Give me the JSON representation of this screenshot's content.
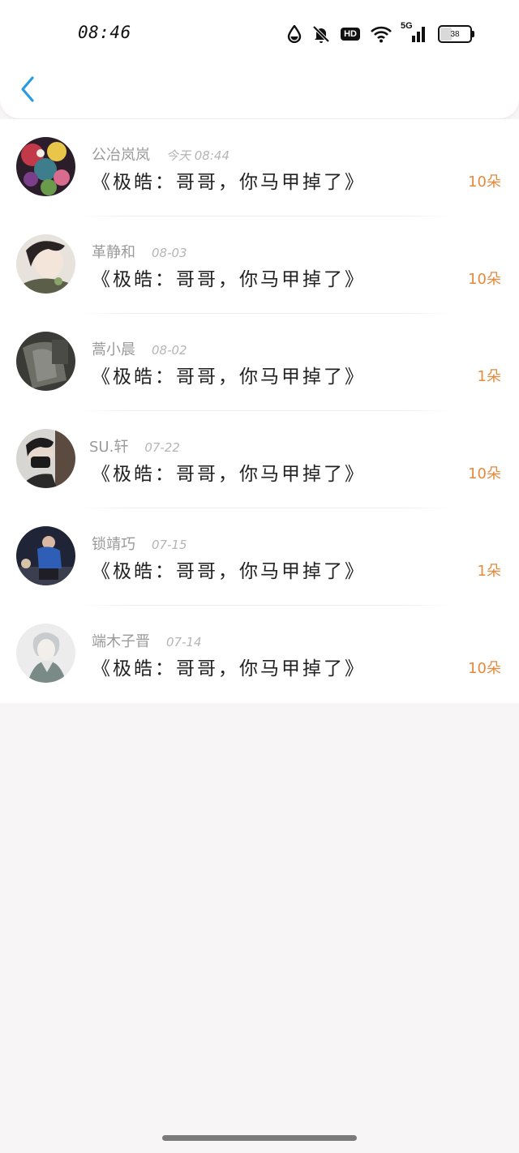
{
  "status_bar": {
    "time": "08:46",
    "icons": [
      "drop-icon",
      "bell-off-icon",
      "hd-icon",
      "wifi-icon",
      "signal-5g-icon",
      "battery-icon"
    ],
    "hd_label": "HD",
    "network_label": "5G",
    "battery_level": "38"
  },
  "header": {
    "back_icon": "chevron-left-icon",
    "accent_color": "#2a9be0"
  },
  "list": [
    {
      "name": "公冶岚岚",
      "date": "今天 08:44",
      "title": "《极皓：哥哥，你马甲掉了》",
      "count": "10朵"
    },
    {
      "name": "革静和",
      "date": "08-03",
      "title": "《极皓：哥哥，你马甲掉了》",
      "count": "10朵"
    },
    {
      "name": "蒿小晨",
      "date": "08-02",
      "title": "《极皓：哥哥，你马甲掉了》",
      "count": "1朵"
    },
    {
      "name": "SU.轩",
      "date": "07-22",
      "title": "《极皓：哥哥，你马甲掉了》",
      "count": "10朵"
    },
    {
      "name": "锁靖巧",
      "date": "07-15",
      "title": "《极皓：哥哥，你马甲掉了》",
      "count": "1朵"
    },
    {
      "name": "端木子晋",
      "date": "07-14",
      "title": "《极皓：哥哥，你马甲掉了》",
      "count": "10朵"
    }
  ],
  "colors": {
    "count": "#e58a3c",
    "name": "#9a9a9a",
    "background": "#f7f5f6"
  }
}
